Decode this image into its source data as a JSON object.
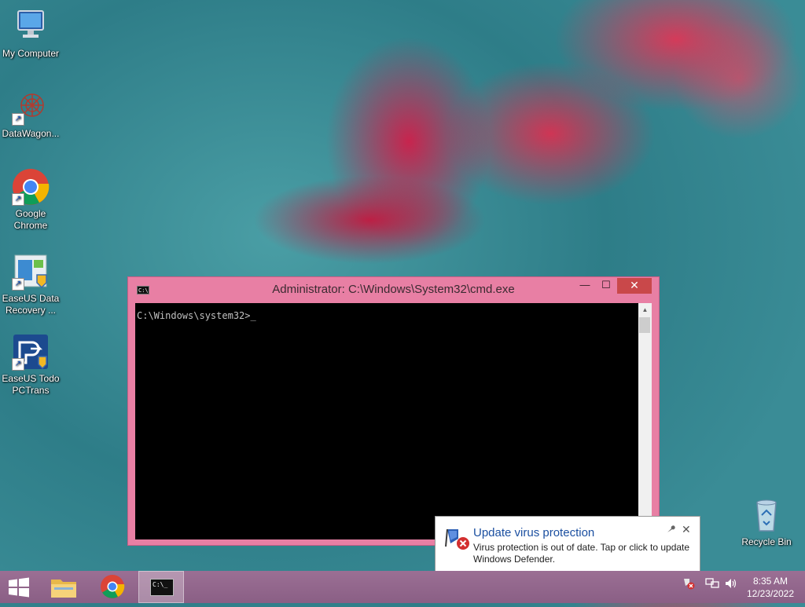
{
  "desktop": {
    "icons": [
      {
        "label": "My Computer"
      },
      {
        "label": "DataWagon..."
      },
      {
        "label": "Google Chrome"
      },
      {
        "label": "EaseUS Data Recovery ..."
      },
      {
        "label": "EaseUS Todo PCTrans"
      },
      {
        "label": "Recycle Bin"
      }
    ]
  },
  "cmd": {
    "title": "Administrator: C:\\Windows\\System32\\cmd.exe",
    "prompt": "C:\\Windows\\system32>",
    "cursor": "_",
    "icon_text": "C:\\",
    "minimize": "—",
    "maximize": "☐",
    "close": "✕"
  },
  "notification": {
    "title": "Update virus protection",
    "body": "Virus protection is out of date. Tap or click to update Windows Defender.",
    "close": "✕",
    "pin": "🔧"
  },
  "taskbar": {
    "cmd_icon_text": "C:\\_",
    "clock": {
      "time": "8:35 AM",
      "date": "12/23/2022"
    }
  },
  "colors": {
    "window_frame": "#e87fa4",
    "close_button": "#c9484a",
    "taskbar": "#8a5f85",
    "toast_title": "#1b4fa0"
  }
}
